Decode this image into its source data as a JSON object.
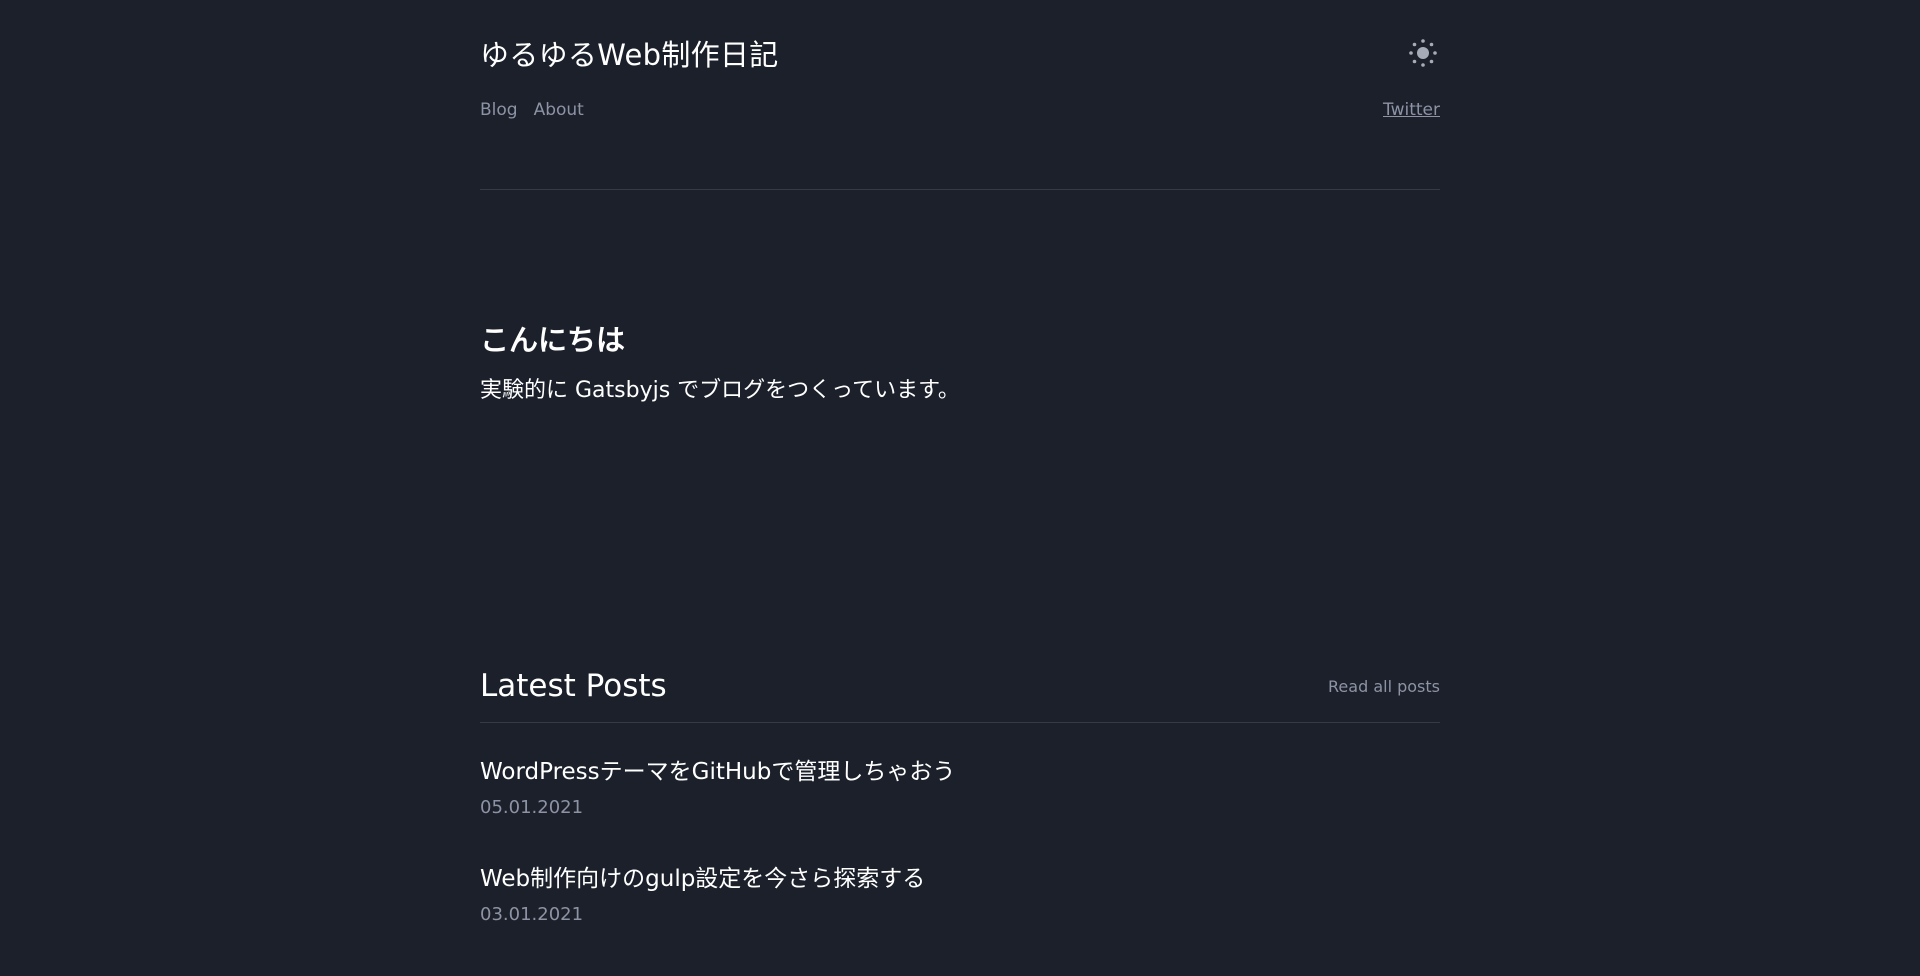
{
  "header": {
    "site_title": "ゆるゆるWeb制作日記",
    "theme_toggle_icon": "sun-icon",
    "nav": [
      {
        "label": "Blog"
      },
      {
        "label": "About"
      }
    ],
    "social_link": "Twitter"
  },
  "hero": {
    "heading": "こんにちは",
    "text": "実験的に Gatsbyjs でブログをつくっています。"
  },
  "latest": {
    "heading": "Latest Posts",
    "read_all": "Read all posts",
    "posts": [
      {
        "title": "WordPressテーマをGitHubで管理しちゃおう",
        "date": "05.01.2021"
      },
      {
        "title": "Web制作向けのgulp設定を今さら探索する",
        "date": "03.01.2021"
      }
    ]
  },
  "colors": {
    "background": "#1b202b",
    "text": "#ffffff",
    "muted": "#8d93a5",
    "divider": "#343a47"
  }
}
